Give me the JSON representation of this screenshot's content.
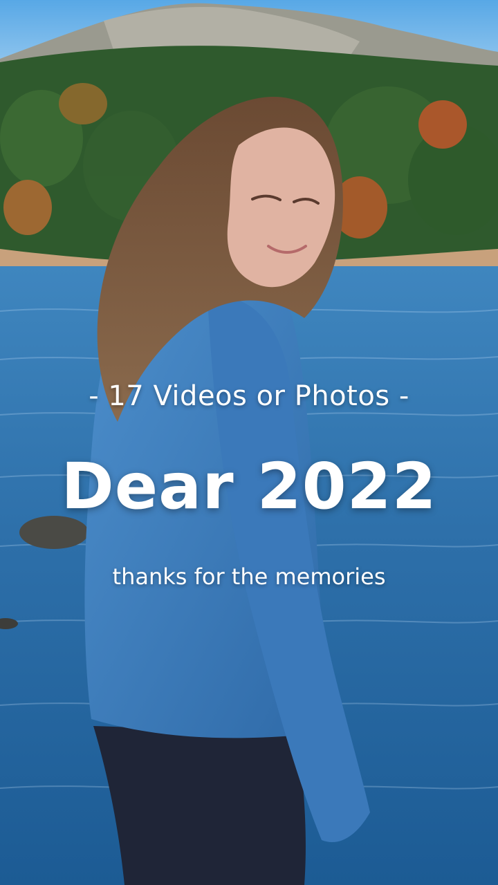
{
  "story": {
    "count_label": "- 17 Videos or Photos -",
    "title": "Dear 2022",
    "subtitle": "thanks for the memories"
  },
  "colors": {
    "sky": "#3b8fd6",
    "water": "#2f76b2",
    "forest": "#2f5a2d",
    "hoodie": "#3a78b8",
    "text": "#ffffff"
  },
  "icons": {
    "photo": "background-photo"
  }
}
